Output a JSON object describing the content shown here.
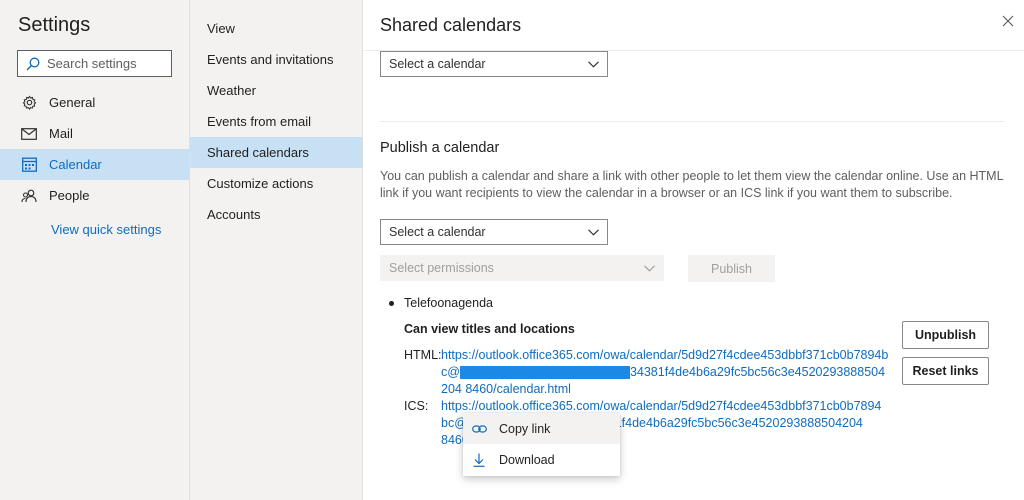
{
  "sidebar": {
    "title": "Settings",
    "search_placeholder": "Search settings",
    "items": [
      {
        "label": "General",
        "icon": "gear-icon"
      },
      {
        "label": "Mail",
        "icon": "mail-icon"
      },
      {
        "label": "Calendar",
        "icon": "calendar-icon",
        "active": true
      },
      {
        "label": "People",
        "icon": "people-icon"
      }
    ],
    "quick_link": "View quick settings"
  },
  "subnav": {
    "items": [
      {
        "label": "View"
      },
      {
        "label": "Events and invitations"
      },
      {
        "label": "Weather"
      },
      {
        "label": "Events from email"
      },
      {
        "label": "Shared calendars",
        "active": true
      },
      {
        "label": "Customize actions"
      },
      {
        "label": "Accounts"
      }
    ]
  },
  "main": {
    "title": "Shared calendars",
    "share_select": "Select a calendar",
    "publish": {
      "heading": "Publish a calendar",
      "description": "You can publish a calendar and share a link with other people to let them view the calendar online. Use an HTML link if you want recipients to view the calendar in a browser or an ICS link if you want them to subscribe.",
      "calendar_select": "Select a calendar",
      "permissions_select": "Select permissions",
      "publish_button": "Publish"
    },
    "published": {
      "calendar_name": "Telefoonagenda",
      "permission": "Can view titles and locations",
      "html_label": "HTML:",
      "html_link_start": "https://outlook.office365.com/owa/calendar/5d9d27f4cdee453dbbf371cb0b7894bc@",
      "html_link_end": "34381f4de4b6a29fc5bc56c3e4520293888504204 8460/calendar.html",
      "ics_label": "ICS:",
      "ics_link_line1": "https://outlook.office365.com/owa/calendar/5d9d27f4cdee453dbbf371cb0b7894",
      "ics_link_line2_start": "bc@",
      "ics_link_line2_end": "34381f4de4b6a29fc5bc56c3e4520293888504204",
      "ics_link_line3": "8460",
      "unpublish_button": "Unpublish",
      "reset_button": "Reset links"
    },
    "context_menu": [
      {
        "label": "Copy link",
        "icon": "link-icon"
      },
      {
        "label": "Download",
        "icon": "download-icon"
      }
    ]
  },
  "colors": {
    "accent": "#0f6cbd",
    "selected_bg": "#c7e0f4",
    "pane_bg": "#f3f2f1"
  }
}
